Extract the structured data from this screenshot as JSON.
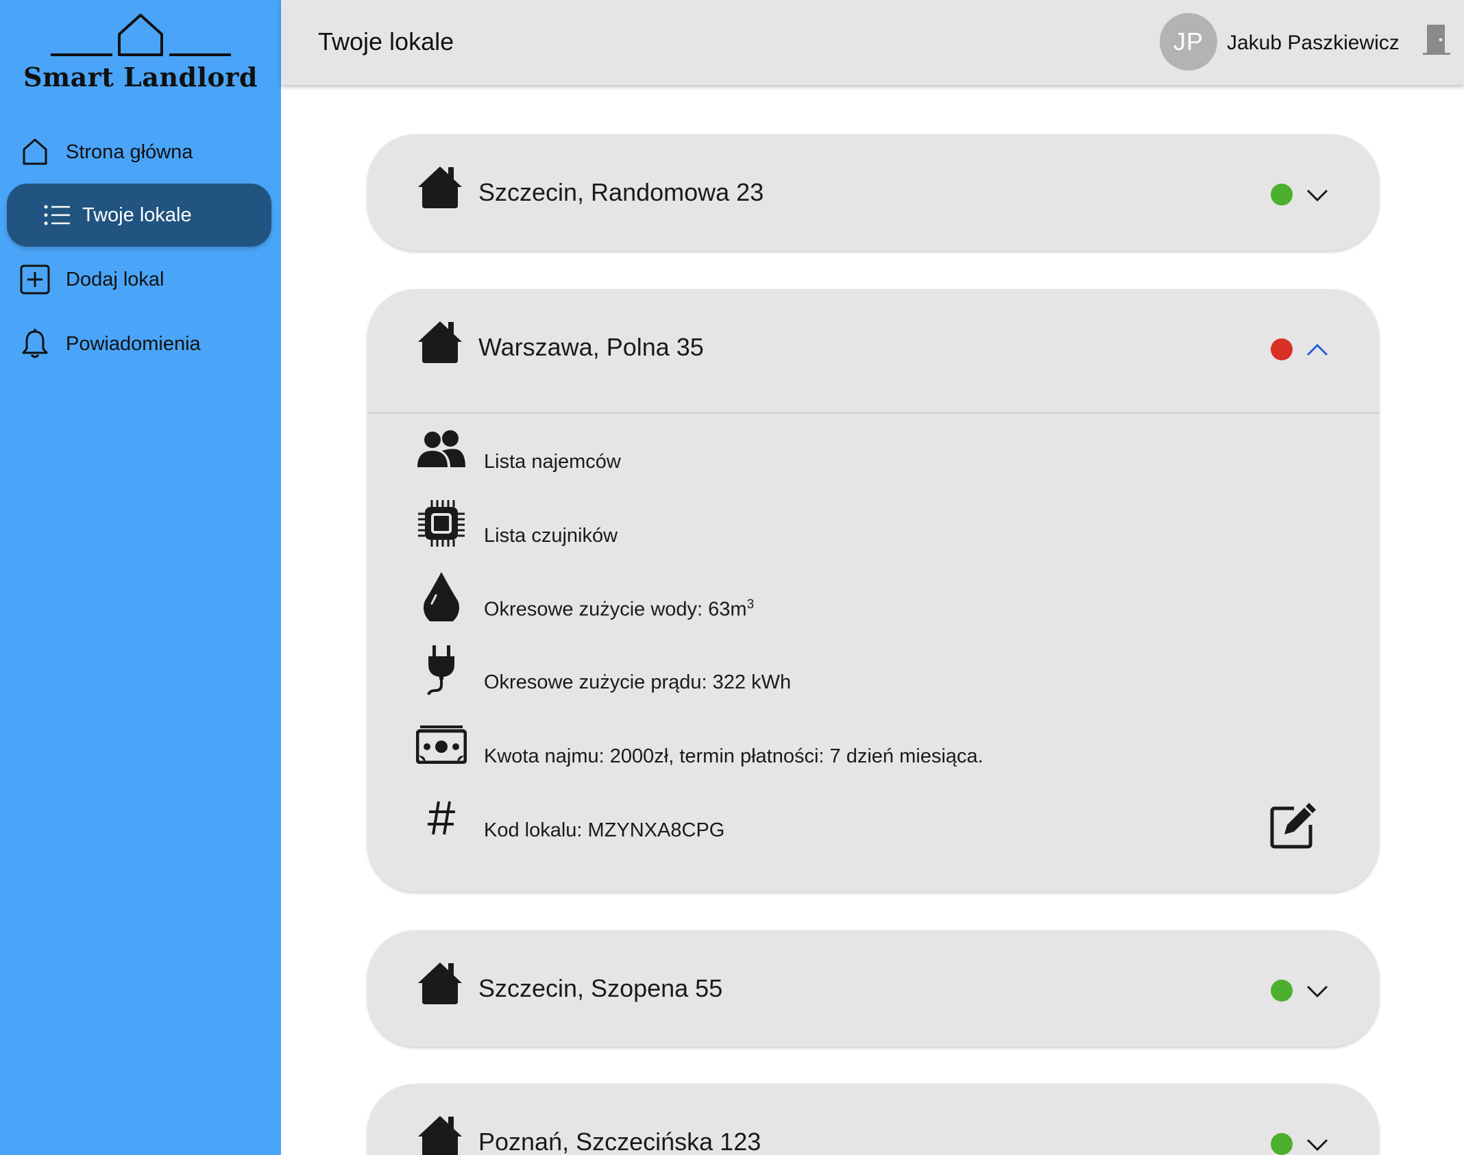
{
  "app": {
    "brand": "Smart Landlord"
  },
  "sidebar": {
    "items": [
      {
        "label": "Strona główna",
        "icon": "home-outline-icon"
      },
      {
        "label": "Twoje lokale",
        "icon": "list-icon",
        "active": true
      },
      {
        "label": "Dodaj lokal",
        "icon": "plus-square-icon"
      },
      {
        "label": "Powiadomienia",
        "icon": "bell-icon"
      }
    ]
  },
  "header": {
    "title": "Twoje lokale",
    "user_initials": "JP",
    "user_name": "Jakub Paszkiewicz"
  },
  "properties": [
    {
      "address": "Szczecin, Randomowa 23",
      "status": "ok",
      "expanded": false
    },
    {
      "address": "Warszawa, Polna 35",
      "status": "alert",
      "expanded": true,
      "details": {
        "tenants": "Lista najemców",
        "sensors": "Lista czujników",
        "water_label": "Okresowe zużycie wody: 63m",
        "water_sup": "3",
        "power": "Okresowe zużycie prądu: 322 kWh",
        "rent": "Kwota najmu: 2000zł, termin płatności: 7 dzień miesiąca.",
        "code": "Kod lokalu: MZYNXA8CPG"
      }
    },
    {
      "address": "Szczecin, Szopena 55",
      "status": "ok",
      "expanded": false
    },
    {
      "address": "Poznań, Szczecińska 123",
      "status": "ok",
      "expanded": false
    }
  ],
  "colors": {
    "sidebar_bg": "#4aa5f8",
    "active_nav": "#215480",
    "status_ok": "#4caf2e",
    "status_alert": "#d93025",
    "chevron_active": "#2a5fd8"
  }
}
